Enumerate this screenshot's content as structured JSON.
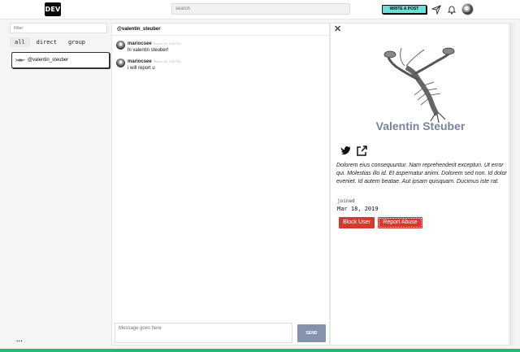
{
  "nav": {
    "logo": "DEV",
    "search_placeholder": "search",
    "write_post": "WRITE A POST"
  },
  "sidebar": {
    "filter_placeholder": "Filter",
    "tabs": [
      "all",
      "direct",
      "group"
    ],
    "channel": "@valentin_steuber",
    "more": "..."
  },
  "chat": {
    "header": "@valentin_steuber",
    "messages": [
      {
        "user": "mariocsee",
        "time": "March 18, 3:08 PM",
        "text": "hi valentin steuber!"
      },
      {
        "user": "mariocsee",
        "time": "March 18, 3:08 PM",
        "text": "i will report u"
      }
    ],
    "composer_placeholder": "Message goes here",
    "send_label": "SEND"
  },
  "profile": {
    "close": "✕",
    "name": "Valentin Steuber",
    "bio": "Dolorem eius consequuntur. Nam reprehenderit excepturi. Ut error qui. Molestias illo id. Et aspernatur animi. Dolorem sed non. Id dolor eveniet. Id autem beatae. Aut ipsam quisquam. Ducimus iste rat.",
    "joined_label": "joined",
    "joined_date": "Mar 18, 2019",
    "block_label": "Block User",
    "report_label": "Report Abuse"
  },
  "colors": {
    "accent_write": "#66e2d5",
    "danger": "#d8372e",
    "send": "#8592ad",
    "name": "#7a829a"
  }
}
